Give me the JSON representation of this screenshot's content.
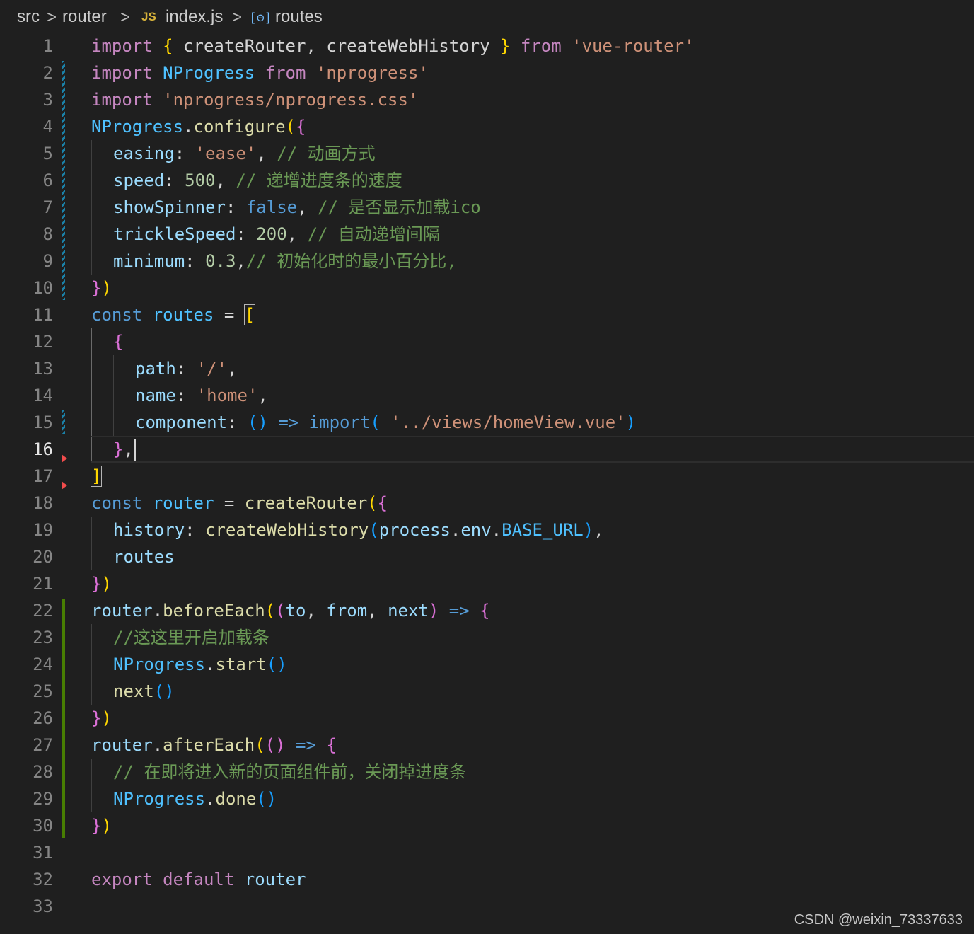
{
  "breadcrumb": {
    "items": [
      "src",
      "router",
      "index.js",
      "routes"
    ],
    "separator": ">",
    "file_icon": "JS",
    "symbol_icon": "[⊖]"
  },
  "editor": {
    "active_line": 16,
    "line_numbers": [
      "1",
      "2",
      "3",
      "4",
      "5",
      "6",
      "7",
      "8",
      "9",
      "10",
      "11",
      "12",
      "13",
      "14",
      "15",
      "16",
      "17",
      "18",
      "19",
      "20",
      "21",
      "22",
      "23",
      "24",
      "25",
      "26",
      "27",
      "28",
      "29",
      "30",
      "31",
      "32",
      "33"
    ]
  },
  "code": {
    "l1": [
      "import",
      " ",
      "{",
      " createRouter, createWebHistory ",
      "}",
      " ",
      "from",
      " ",
      "'vue-router'"
    ],
    "l2": [
      "import",
      " ",
      "NProgress",
      " ",
      "from",
      " ",
      "'nprogress'"
    ],
    "l3": [
      "import",
      " ",
      "'nprogress/nprogress.css'"
    ],
    "l4": [
      "NProgress",
      ".",
      "configure",
      "(",
      "{"
    ],
    "l5": [
      "easing",
      ": ",
      "'ease'",
      ", ",
      "// 动画方式"
    ],
    "l6": [
      "speed",
      ": ",
      "500",
      ", ",
      "// 递增进度条的速度"
    ],
    "l7": [
      "showSpinner",
      ": ",
      "false",
      ", ",
      "// 是否显示加载ico"
    ],
    "l8": [
      "trickleSpeed",
      ": ",
      "200",
      ", ",
      "// 自动递增间隔"
    ],
    "l9": [
      "minimum",
      ": ",
      "0.3",
      ",",
      "// 初始化时的最小百分比,"
    ],
    "l10": [
      "}",
      ")"
    ],
    "l11": [
      "const",
      " ",
      "routes",
      " = ",
      "["
    ],
    "l12": [
      "{"
    ],
    "l13": [
      "path",
      ": ",
      "'/'",
      ","
    ],
    "l14": [
      "name",
      ": ",
      "'home'",
      ","
    ],
    "l15": [
      "component",
      ": ",
      "()",
      " ",
      "=>",
      " ",
      "import",
      "(",
      " ",
      "'../views/homeView.vue'",
      ")"
    ],
    "l16": [
      "}",
      ","
    ],
    "l17": [
      "]"
    ],
    "l18": [
      "const",
      " ",
      "router",
      " = ",
      "createRouter",
      "(",
      "{"
    ],
    "l19": [
      "history",
      ": ",
      "createWebHistory",
      "(",
      "process",
      ".",
      "env",
      ".",
      "BASE_URL",
      ")",
      ","
    ],
    "l20": [
      "routes"
    ],
    "l21": [
      "}",
      ")"
    ],
    "l22": [
      "router",
      ".",
      "beforeEach",
      "(",
      "(",
      "to",
      ", ",
      "from",
      ", ",
      "next",
      ")",
      " ",
      "=>",
      " ",
      "{"
    ],
    "l23": [
      "//这这里开启加载条"
    ],
    "l24": [
      "NProgress",
      ".",
      "start",
      "()"
    ],
    "l25": [
      "next",
      "()"
    ],
    "l26": [
      "}",
      ")"
    ],
    "l27": [
      "router",
      ".",
      "afterEach",
      "(",
      "()",
      " ",
      "=>",
      " ",
      "{"
    ],
    "l28": [
      "// 在即将进入新的页面组件前，关闭掉进度条"
    ],
    "l29": [
      "NProgress",
      ".",
      "done",
      "()"
    ],
    "l30": [
      "}",
      ")"
    ],
    "l31": [],
    "l32": [
      "export",
      " ",
      "default",
      " ",
      "router"
    ],
    "l33": []
  },
  "watermark": "CSDN @weixin_73337633",
  "colors": {
    "background": "#1f1f1f",
    "keyword_control": "#c586c0",
    "keyword_declaration": "#569cd6",
    "variable": "#9cdcfe",
    "constant": "#4fc1ff",
    "function": "#dcdcaa",
    "string": "#ce9178",
    "number": "#b5cea8",
    "comment": "#6a9955",
    "bracket_level1": "#ffd700",
    "bracket_level2": "#da70d6",
    "bracket_level3": "#179fff",
    "gutter_modified": "#1b81a8",
    "gutter_added": "#487e02",
    "gutter_deleted": "#f14c4c"
  }
}
